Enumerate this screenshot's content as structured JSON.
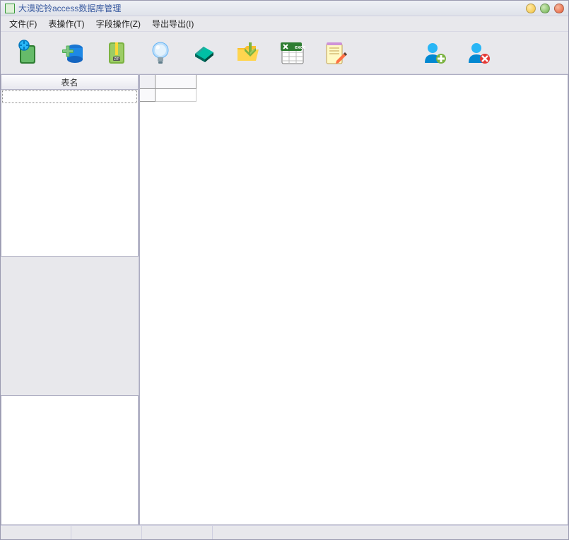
{
  "window": {
    "title": "大漠驼铃access数据库管理"
  },
  "menu": {
    "file": "文件(F)",
    "table_ops": "表操作(T)",
    "field_ops": "字段操作(Z)",
    "import_export": "导出导出(I)"
  },
  "toolbar": {
    "icons": {
      "open_db": "open-database-icon",
      "add_db": "add-database-icon",
      "zip": "zip-archive-icon",
      "bulb": "lightbulb-icon",
      "book": "book-icon",
      "download_folder": "download-folder-icon",
      "excel": "excel-icon",
      "notepad": "notepad-edit-icon",
      "user_add": "user-add-icon",
      "user_remove": "user-remove-icon"
    }
  },
  "left_pane": {
    "header": "表名"
  },
  "statusbar": {
    "cell1": "",
    "cell2": "",
    "cell3": ""
  }
}
